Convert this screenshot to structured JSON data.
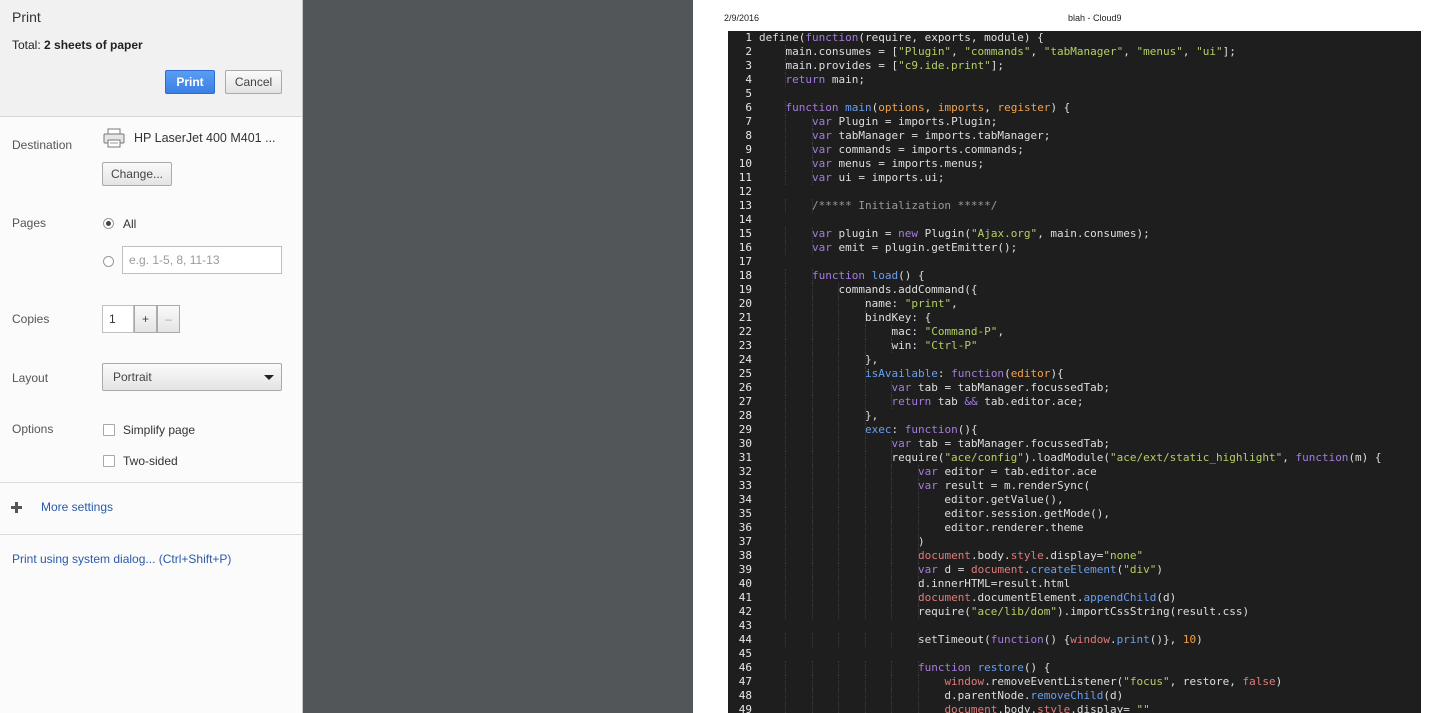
{
  "panel": {
    "title": "Print",
    "total_label": "Total: ",
    "total_value": "2 sheets of paper",
    "print_button": "Print",
    "cancel_button": "Cancel",
    "destination_label": "Destination",
    "printer_name": "HP LaserJet 400 M401 ...",
    "change_button": "Change...",
    "pages_label": "Pages",
    "pages_all": "All",
    "pages_placeholder": "e.g. 1-5, 8, 11-13",
    "copies_label": "Copies",
    "copies_value": "1",
    "copies_plus": "+",
    "copies_minus": "–",
    "layout_label": "Layout",
    "layout_value": "Portrait",
    "options_label": "Options",
    "simplify_label": "Simplify page",
    "two_sided_label": "Two-sided",
    "more_settings": "More settings",
    "system_dialog": "Print using system dialog... (Ctrl+Shift+P)"
  },
  "preview": {
    "date": "2/9/2016",
    "page_title": "blah - Cloud9"
  },
  "code": {
    "lines": [
      [
        [
          "define(",
          ""
        ],
        [
          "function",
          "kw"
        ],
        [
          "(require, exports, module) {",
          ""
        ]
      ],
      [
        [
          "    main.consumes = [",
          ""
        ],
        [
          "\"Plugin\"",
          "st"
        ],
        [
          ", ",
          ""
        ],
        [
          "\"commands\"",
          "st"
        ],
        [
          ", ",
          ""
        ],
        [
          "\"tabManager\"",
          "st"
        ],
        [
          ", ",
          ""
        ],
        [
          "\"menus\"",
          "st"
        ],
        [
          ", ",
          ""
        ],
        [
          "\"ui\"",
          "st"
        ],
        [
          "];",
          ""
        ]
      ],
      [
        [
          "    main.provides = [",
          ""
        ],
        [
          "\"c9.ide.print\"",
          "st"
        ],
        [
          "];",
          ""
        ]
      ],
      [
        [
          "    ",
          ""
        ],
        [
          "return",
          "kw"
        ],
        [
          " main;",
          ""
        ]
      ],
      [],
      [
        [
          "    ",
          ""
        ],
        [
          "function",
          "kw"
        ],
        [
          " ",
          ""
        ],
        [
          "main",
          "fn"
        ],
        [
          "(",
          ""
        ],
        [
          "options",
          "pa"
        ],
        [
          ", ",
          ""
        ],
        [
          "imports",
          "pa"
        ],
        [
          ", ",
          ""
        ],
        [
          "register",
          "pa"
        ],
        [
          ") {",
          ""
        ]
      ],
      [
        [
          "        ",
          ""
        ],
        [
          "var",
          "kw"
        ],
        [
          " Plugin = imports.Plugin;",
          ""
        ]
      ],
      [
        [
          "        ",
          ""
        ],
        [
          "var",
          "kw"
        ],
        [
          " tabManager = imports.tabManager;",
          ""
        ]
      ],
      [
        [
          "        ",
          ""
        ],
        [
          "var",
          "kw"
        ],
        [
          " commands = imports.commands;",
          ""
        ]
      ],
      [
        [
          "        ",
          ""
        ],
        [
          "var",
          "kw"
        ],
        [
          " menus = imports.menus;",
          ""
        ]
      ],
      [
        [
          "        ",
          ""
        ],
        [
          "var",
          "kw"
        ],
        [
          " ui = imports.ui;",
          ""
        ]
      ],
      [],
      [
        [
          "        ",
          ""
        ],
        [
          "/***** Initialization *****/",
          "cm"
        ]
      ],
      [],
      [
        [
          "        ",
          ""
        ],
        [
          "var",
          "kw"
        ],
        [
          " plugin = ",
          ""
        ],
        [
          "new",
          "kw"
        ],
        [
          " Plugin(",
          ""
        ],
        [
          "\"Ajax.org\"",
          "st"
        ],
        [
          ", main.consumes);",
          ""
        ]
      ],
      [
        [
          "        ",
          ""
        ],
        [
          "var",
          "kw"
        ],
        [
          " emit = plugin.getEmitter();",
          ""
        ]
      ],
      [],
      [
        [
          "        ",
          ""
        ],
        [
          "function",
          "kw"
        ],
        [
          " ",
          ""
        ],
        [
          "load",
          "fn"
        ],
        [
          "() {",
          ""
        ]
      ],
      [
        [
          "            commands.addCommand({",
          ""
        ]
      ],
      [
        [
          "                name: ",
          ""
        ],
        [
          "\"print\"",
          "st"
        ],
        [
          ",",
          ""
        ]
      ],
      [
        [
          "                bindKey: {",
          ""
        ]
      ],
      [
        [
          "                    mac: ",
          ""
        ],
        [
          "\"Command-P\"",
          "st"
        ],
        [
          ",",
          ""
        ]
      ],
      [
        [
          "                    win: ",
          ""
        ],
        [
          "\"Ctrl-P\"",
          "st"
        ]
      ],
      [
        [
          "                },",
          ""
        ]
      ],
      [
        [
          "                ",
          ""
        ],
        [
          "isAvailable",
          "fn"
        ],
        [
          ": ",
          ""
        ],
        [
          "function",
          "kw"
        ],
        [
          "(",
          ""
        ],
        [
          "editor",
          "pa"
        ],
        [
          "){",
          ""
        ]
      ],
      [
        [
          "                    ",
          ""
        ],
        [
          "var",
          "kw"
        ],
        [
          " tab = tabManager.focussedTab;",
          ""
        ]
      ],
      [
        [
          "                    ",
          ""
        ],
        [
          "return",
          "kw"
        ],
        [
          " tab ",
          ""
        ],
        [
          "&&",
          "kw"
        ],
        [
          " tab.editor.ace;",
          ""
        ]
      ],
      [
        [
          "                },",
          ""
        ]
      ],
      [
        [
          "                ",
          ""
        ],
        [
          "exec",
          "fn"
        ],
        [
          ": ",
          ""
        ],
        [
          "function",
          "kw"
        ],
        [
          "(){",
          ""
        ]
      ],
      [
        [
          "                    ",
          ""
        ],
        [
          "var",
          "kw"
        ],
        [
          " tab = tabManager.focussedTab;",
          ""
        ]
      ],
      [
        [
          "                    require(",
          ""
        ],
        [
          "\"ace/config\"",
          "st"
        ],
        [
          ").loadModule(",
          ""
        ],
        [
          "\"ace/ext/static_highlight\"",
          "st"
        ],
        [
          ", ",
          ""
        ],
        [
          "function",
          "kw"
        ],
        [
          "(m) {",
          ""
        ]
      ],
      [
        [
          "                        ",
          ""
        ],
        [
          "var",
          "kw"
        ],
        [
          " editor = tab.editor.ace",
          ""
        ]
      ],
      [
        [
          "                        ",
          ""
        ],
        [
          "var",
          "kw"
        ],
        [
          " result = m.renderSync(",
          ""
        ]
      ],
      [
        [
          "                            editor.getValue(),",
          ""
        ]
      ],
      [
        [
          "                            editor.session.getMode(),",
          ""
        ]
      ],
      [
        [
          "                            editor.renderer.theme",
          ""
        ]
      ],
      [
        [
          "                        )",
          ""
        ]
      ],
      [
        [
          "                        ",
          ""
        ],
        [
          "document",
          "ob"
        ],
        [
          ".body.",
          ""
        ],
        [
          "style",
          "ob"
        ],
        [
          ".display=",
          ""
        ],
        [
          "\"none\"",
          "st"
        ]
      ],
      [
        [
          "                        ",
          ""
        ],
        [
          "var",
          "kw"
        ],
        [
          " d = ",
          ""
        ],
        [
          "document",
          "ob"
        ],
        [
          ".",
          ""
        ],
        [
          "createElement",
          "fn"
        ],
        [
          "(",
          ""
        ],
        [
          "\"div\"",
          "st"
        ],
        [
          ")",
          ""
        ]
      ],
      [
        [
          "                        d.innerHTML=result.html",
          ""
        ]
      ],
      [
        [
          "                        ",
          ""
        ],
        [
          "document",
          "ob"
        ],
        [
          ".documentElement.",
          ""
        ],
        [
          "appendChild",
          "fn"
        ],
        [
          "(d)",
          ""
        ]
      ],
      [
        [
          "                        require(",
          ""
        ],
        [
          "\"ace/lib/dom\"",
          "st"
        ],
        [
          ").importCssString(result.css)",
          ""
        ]
      ],
      [],
      [
        [
          "                        setTimeout(",
          ""
        ],
        [
          "function",
          "kw"
        ],
        [
          "() {",
          ""
        ],
        [
          "window",
          "ob"
        ],
        [
          ".",
          ""
        ],
        [
          "print",
          "fn"
        ],
        [
          "()}, ",
          ""
        ],
        [
          "10",
          "pa"
        ],
        [
          ")",
          ""
        ]
      ],
      [],
      [
        [
          "                        ",
          ""
        ],
        [
          "function",
          "kw"
        ],
        [
          " ",
          ""
        ],
        [
          "restore",
          "fn"
        ],
        [
          "() {",
          ""
        ]
      ],
      [
        [
          "                            ",
          ""
        ],
        [
          "window",
          "ob"
        ],
        [
          ".removeEventListener(",
          ""
        ],
        [
          "\"focus\"",
          "st"
        ],
        [
          ", restore, ",
          ""
        ],
        [
          "false",
          "ob"
        ],
        [
          ")",
          ""
        ]
      ],
      [
        [
          "                            d.parentNode.",
          ""
        ],
        [
          "removeChild",
          "fn"
        ],
        [
          "(d)",
          ""
        ]
      ],
      [
        [
          "                            ",
          ""
        ],
        [
          "document",
          "ob"
        ],
        [
          ".body.",
          ""
        ],
        [
          "style",
          "ob"
        ],
        [
          ".display= ",
          ""
        ],
        [
          "\"\"",
          "st"
        ]
      ]
    ]
  }
}
